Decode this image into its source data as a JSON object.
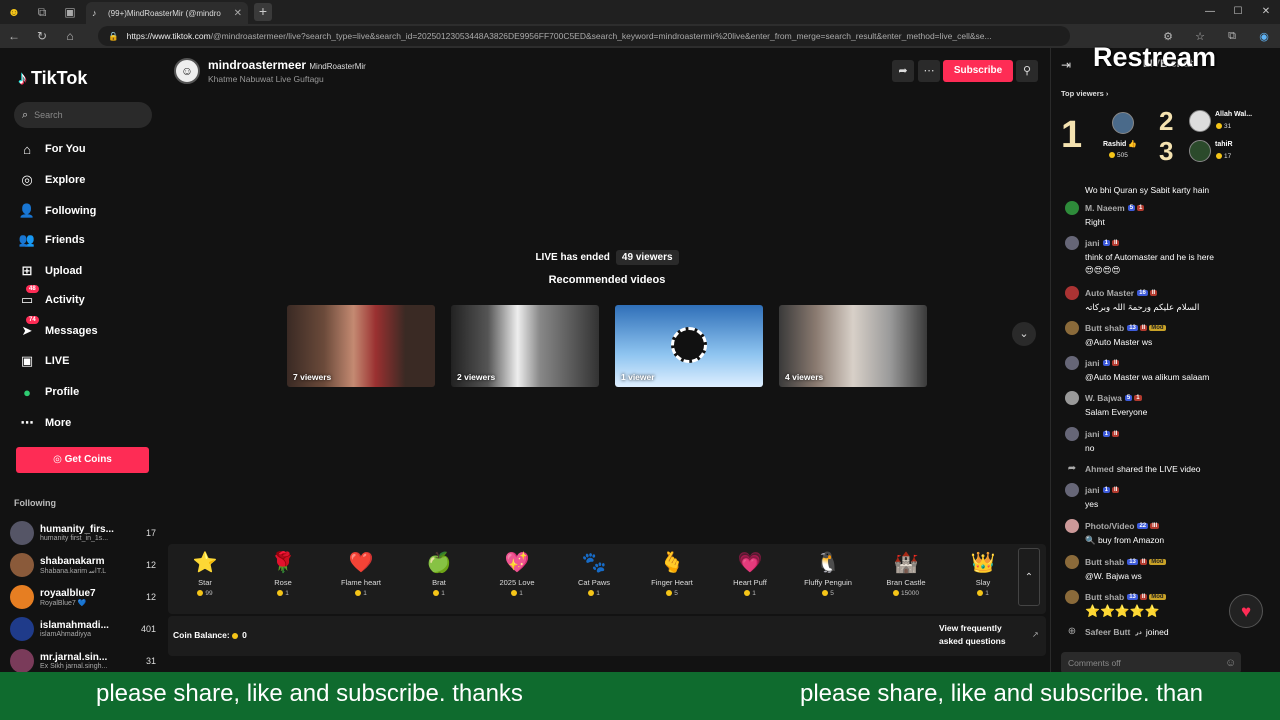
{
  "browser": {
    "tab_title": "(99+)MindRoasterMir (@mindro",
    "url_host": "https://www.tiktok.com",
    "url_path": "/@mindroastermeer/live?search_type=live&search_id=20250123053448A3826DE9956FF700C5ED&search_keyword=mindroastermir%20live&enter_from_merge=search_result&enter_method=live_cell&se..."
  },
  "sidebar": {
    "logo": "TikTok",
    "search_placeholder": "Search",
    "nav": [
      {
        "label": "For You",
        "icon": "home-icon"
      },
      {
        "label": "Explore",
        "icon": "compass-icon"
      },
      {
        "label": "Following",
        "icon": "following-icon"
      },
      {
        "label": "Friends",
        "icon": "friends-icon"
      },
      {
        "label": "Upload",
        "icon": "upload-icon"
      },
      {
        "label": "Activity",
        "icon": "activity-icon",
        "badge": "48"
      },
      {
        "label": "Messages",
        "icon": "messages-icon",
        "badge": "74"
      },
      {
        "label": "LIVE",
        "icon": "live-icon"
      },
      {
        "label": "Profile",
        "icon": "profile-icon"
      },
      {
        "label": "More",
        "icon": "more-icon"
      }
    ],
    "get_coins": "Get Coins",
    "following_heading": "Following",
    "following": [
      {
        "name": "humanity_firs...",
        "sub": "humanity first_in_1s...",
        "count": "17"
      },
      {
        "name": "shabanakarm",
        "sub": "Shabana.karim ﺍﺳT.L",
        "count": "12"
      },
      {
        "name": "royaalblue7",
        "sub": "RoyalBlue7 💙",
        "count": "12"
      },
      {
        "name": "islamahmadi...",
        "sub": "islamAhmadiyya",
        "count": "401"
      },
      {
        "name": "mr.jarnal.sin...",
        "sub": "Ex Sikh jarnal.singh...",
        "count": "31"
      }
    ]
  },
  "host": {
    "username": "mindroastermeer",
    "nickname": "MindRoasterMir",
    "live_title": "Khatme Nabuwat Live Guftagu",
    "subscribe_label": "Subscribe"
  },
  "stream": {
    "ended_text": "LIVE has ended",
    "viewers": "49 viewers",
    "recommended_title": "Recommended videos",
    "thumbnails": [
      {
        "label": "7 viewers"
      },
      {
        "label": "2 viewers"
      },
      {
        "label": "1 viewer"
      },
      {
        "label": "4 viewers"
      }
    ]
  },
  "gifts": [
    {
      "name": "Star",
      "price": "99",
      "icon": "⭐"
    },
    {
      "name": "Rose",
      "price": "1",
      "icon": "🌹"
    },
    {
      "name": "Flame heart",
      "price": "1",
      "icon": "❤️"
    },
    {
      "name": "Brat",
      "price": "1",
      "icon": "🍏"
    },
    {
      "name": "2025 Love",
      "price": "1",
      "icon": "💖"
    },
    {
      "name": "Cat Paws",
      "price": "1",
      "icon": "🐾"
    },
    {
      "name": "Finger Heart",
      "price": "5",
      "icon": "🫰"
    },
    {
      "name": "Heart Puff",
      "price": "1",
      "icon": "💗"
    },
    {
      "name": "Fluffy Penguin",
      "price": "5",
      "icon": "🐧"
    },
    {
      "name": "Bran Castle",
      "price": "15000",
      "icon": "🏰"
    },
    {
      "name": "Slay",
      "price": "1",
      "icon": "👑"
    }
  ],
  "coin_bar": {
    "balance_label": "Coin Balance:",
    "balance_value": "0",
    "faq": "View frequently asked questions"
  },
  "chat": {
    "title": "LIVE chat",
    "overlay_brand": "Restream",
    "top_viewers_label": "Top viewers",
    "top_viewers": [
      {
        "rank": "1",
        "name": "Rashid 👍",
        "coins": "505"
      },
      {
        "rank": "2",
        "name": "Allah Wal...",
        "coins": "31"
      },
      {
        "rank": "3",
        "name": "tahiR",
        "coins": "17"
      }
    ],
    "messages": [
      {
        "user": "",
        "text": "Wo bhi Quran sy Sabit karty hain"
      },
      {
        "user": "M. Naeem",
        "lvl": "5",
        "fan": "1",
        "text": "Right"
      },
      {
        "user": "jani",
        "lvl": "1",
        "fan": "II",
        "text": "think of Automaster and he is here"
      },
      {
        "user": "Auto Master",
        "lvl": "16",
        "fan": "II",
        "text": "السلام علیکم ورحمۃ اللہ وبرکاتہ"
      },
      {
        "user": "Butt shab",
        "lvl": "13",
        "fan": "II",
        "mod": "Mod",
        "text": "@Auto Master ws"
      },
      {
        "user": "jani",
        "lvl": "1",
        "fan": "II",
        "text": "@Auto Master wa alikum salaam"
      },
      {
        "user": "W. Bajwa",
        "lvl": "5",
        "fan": "1",
        "text": "Salam Everyone"
      },
      {
        "user": "jani",
        "lvl": "1",
        "fan": "II",
        "text": "no"
      },
      {
        "user": "Ahmed",
        "text": "shared the LIVE video"
      },
      {
        "user": "jani",
        "lvl": "1",
        "fan": "II",
        "text": "yes"
      },
      {
        "user": "Photo/Video",
        "lvl": "22",
        "fan": "III",
        "text": "🔍 buy from Amazon"
      },
      {
        "user": "Butt shab",
        "lvl": "13",
        "fan": "II",
        "mod": "Mod",
        "text": "@W. Bajwa ws"
      },
      {
        "user": "Butt shab",
        "lvl": "13",
        "fan": "II",
        "mod": "Mod",
        "text": "⭐⭐⭐⭐⭐"
      },
      {
        "user": "Safeer Butt",
        "tag": "ﺩﺭ",
        "text": "joined"
      }
    ],
    "comments_off": "Comments off"
  },
  "ticker": {
    "text": "please share, like and subscribe. thanks",
    "text2": "please share, like and subscribe. than"
  },
  "colors": {
    "accent": "#fe2c55",
    "ticker_bg": "#0f6b2e",
    "coin": "#f5c518"
  }
}
